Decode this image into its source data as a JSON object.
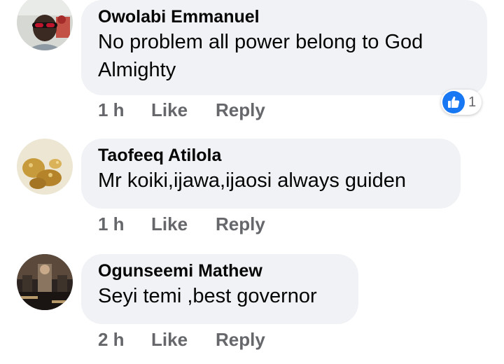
{
  "comments": [
    {
      "author": "Owolabi Emmanuel",
      "text": "No problem all power belong to God Almighty",
      "time": "1 h",
      "like_label": "Like",
      "reply_label": "Reply",
      "avatar_icon": "user-avatar-man-red-sunglasses",
      "reactions": {
        "icon": "thumbs-up-icon",
        "count": "1",
        "color": "#1877f2"
      }
    },
    {
      "author": "Taofeeq Atilola",
      "text": "Mr koiki,ijawa,ijaosi always guiden",
      "time": "1 h",
      "like_label": "Like",
      "reply_label": "Reply",
      "avatar_icon": "user-avatar-gold-nuggets"
    },
    {
      "author": "Ogunseemi Mathew",
      "text": "Seyi temi ,best governor",
      "time": "2 h",
      "like_label": "Like",
      "reply_label": "Reply",
      "avatar_icon": "user-avatar-dark-photo"
    }
  ],
  "colors": {
    "bubble_bg": "#f0f2f5",
    "meta_text": "#65676b",
    "body_text": "#050505",
    "like_blue": "#1877f2"
  }
}
